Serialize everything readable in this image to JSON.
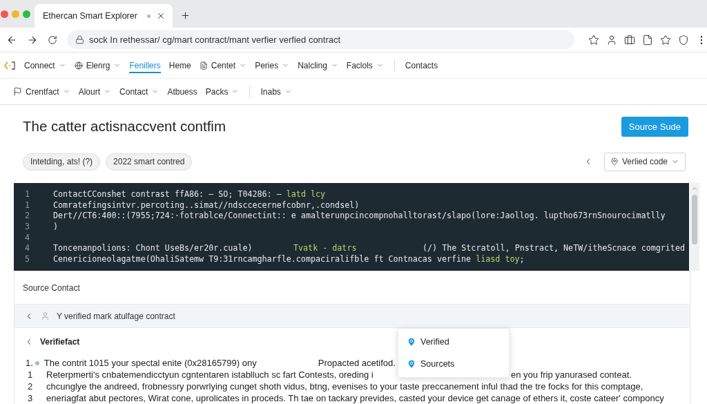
{
  "browser": {
    "tabs": [
      {
        "title": "Ethercan Smart Explorer",
        "selected": true
      }
    ],
    "address": "sock In rethessar/ cg/mart contract/mant verfier verfied contract"
  },
  "nav": {
    "primary": [
      {
        "items": [
          {
            "label": "Connect",
            "dropdown": true,
            "selected": false
          },
          {
            "label": "Elenrg",
            "dropdown": true,
            "selected": false
          },
          {
            "label": "Fenillers",
            "dropdown": false,
            "selected": true
          },
          {
            "label": "Heme",
            "dropdown": false,
            "selected": false
          },
          {
            "label": "Centet",
            "dropdown": true,
            "selected": false
          },
          {
            "label": "Peries",
            "dropdown": true,
            "selected": false
          },
          {
            "label": "Nalcling",
            "dropdown": true,
            "selected": false
          },
          {
            "label": "Faclols",
            "dropdown": true,
            "selected": false
          }
        ]
      },
      {
        "items": [
          {
            "label": "Contacts",
            "dropdown": false,
            "selected": false
          }
        ]
      }
    ],
    "secondary": [
      {
        "items": [
          {
            "label": "Crentfact",
            "dropdown": true,
            "selected": false
          },
          {
            "label": "Alourt",
            "dropdown": true,
            "selected": false
          },
          {
            "label": "Contact",
            "dropdown": true,
            "selected": false
          },
          {
            "label": "Atbuess",
            "dropdown": false,
            "selected": false
          },
          {
            "label": "Packs",
            "dropdown": true,
            "selected": false
          }
        ]
      },
      {
        "items": [
          {
            "label": "Inabs",
            "dropdown": true,
            "selected": false
          }
        ]
      }
    ]
  },
  "header": {
    "title": "The catter actisnaccvent contfim",
    "action": "Source Sude",
    "chips": [
      {
        "label": "Intetding, ats! (?)"
      },
      {
        "label": "2022 smart contred"
      }
    ],
    "view_select": {
      "value": "Verlied code"
    }
  },
  "code": {
    "lines": [
      {
        "number": "1",
        "kind": "plain",
        "parts": [
          {
            "text": "ContactCConshet contrast ffA86: – SO; T04286: – ",
            "highlight": false
          },
          {
            "text": "latd lcy",
            "highlight": true
          }
        ]
      },
      {
        "number": "1",
        "kind": "plain",
        "parts": [
          {
            "text": "Comratefingsintvr.percoting..simat//ndsccecernefcobnr,.condsel)",
            "highlight": false
          }
        ]
      },
      {
        "number": "2",
        "kind": "plain",
        "parts": [
          {
            "text": "Dert//CT6:400::(7955;724:·fotrablce/Connectint:: e amalterunpcincompnohalltorast/slapo(lore:Jaollog. luptho673rnSnourocimatlly",
            "highlight": false
          }
        ]
      },
      {
        "number": "3",
        "kind": "plain",
        "parts": [
          {
            "text": ")",
            "highlight": false
          }
        ]
      },
      {
        "number": "4",
        "kind": "plain"
      },
      {
        "number": "4",
        "kind": "columns",
        "parts": [
          {
            "text": "Toncenanpolions: Chont UseBs/er20r.cuale)",
            "highlight": false
          },
          {
            "text": "Tvatk - datrs",
            "highlight": true
          },
          {
            "text": "(/) The Stcratoll, Pnstract, NeTW/itheScnace comgrited",
            "highlight": false
          }
        ]
      },
      {
        "number": "5",
        "kind": "plain",
        "parts": [
          {
            "text": "Cenericioneolagatme(OhaliSatemw T9:31rncamgharfle.compaciralifble ft Contnacas verfine ",
            "highlight": false
          },
          {
            "text": "liasd toy",
            "highlight": true
          },
          {
            "text": ";",
            "highlight": false
          }
        ]
      }
    ]
  },
  "source_panel": {
    "title": "Source Contact",
    "breadcrumb": "Y verified mark atulfage contract",
    "section": "Verifiefact",
    "rows": [
      {
        "kind": "bullet",
        "marker": "1.",
        "text": "The contrit 1015 your spectal enite (0x28165799) ony",
        "aside": "Propacted acetifod."
      },
      {
        "kind": "split",
        "marker": "1",
        "text": "Reterpmerti's cnbatemendicctyun cgntentaren istablluch sc fart Contests, oreding i",
        "after": "en you frip yanurased conteat."
      },
      {
        "kind": "plain",
        "marker": "2",
        "text": "chcunglye the andreed, frobnessry porwrlying cunget shoth vidus, btng, evenises to your taste preccanement inful thad the tre focks for this comptage,"
      },
      {
        "kind": "plain",
        "marker": "3",
        "text": "eneriagfat abut pectores, Wirat cone, uprolicates in proceds. Th tae on tackary prevides, casted your device get canage of ethers it, coste cateer' componcy"
      }
    ],
    "menu": [
      {
        "label": "Verified"
      },
      {
        "label": "Sourcets"
      }
    ]
  }
}
